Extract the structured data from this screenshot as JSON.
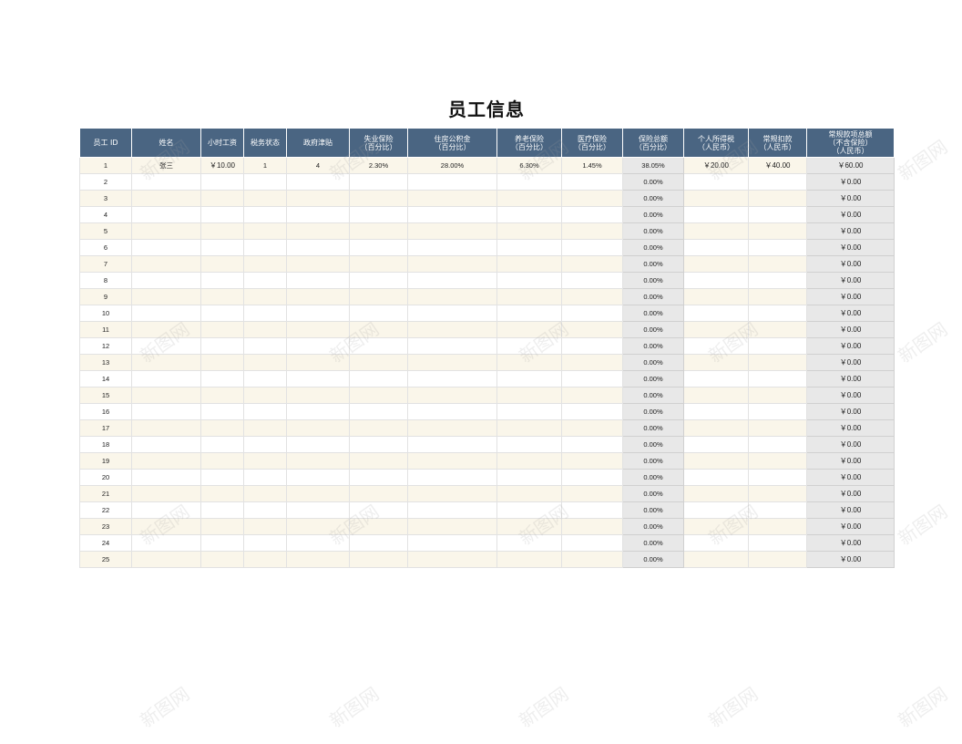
{
  "title": "员工信息",
  "columns": [
    "员工 ID",
    "姓名",
    "小时工资",
    "税务状态",
    "政府津贴",
    "失业保险\n（百分比）",
    "住房公积金\n（百分比）",
    "养老保险\n（百分比）",
    "医疗保险\n（百分比）",
    "保险总额\n（百分比）",
    "个人所得税\n（人民币）",
    "常规扣款\n（人民币）",
    "常规款项总额\n（不含保险）\n（人民币）"
  ],
  "rows": [
    [
      "1",
      "张三",
      "￥10.00",
      "1",
      "4",
      "2.30%",
      "28.00%",
      "6.30%",
      "1.45%",
      "38.05%",
      "￥20.00",
      "￥40.00",
      "￥60.00"
    ],
    [
      "2",
      "",
      "",
      "",
      "",
      "",
      "",
      "",
      "",
      "0.00%",
      "",
      "",
      "￥0.00"
    ],
    [
      "3",
      "",
      "",
      "",
      "",
      "",
      "",
      "",
      "",
      "0.00%",
      "",
      "",
      "￥0.00"
    ],
    [
      "4",
      "",
      "",
      "",
      "",
      "",
      "",
      "",
      "",
      "0.00%",
      "",
      "",
      "￥0.00"
    ],
    [
      "5",
      "",
      "",
      "",
      "",
      "",
      "",
      "",
      "",
      "0.00%",
      "",
      "",
      "￥0.00"
    ],
    [
      "6",
      "",
      "",
      "",
      "",
      "",
      "",
      "",
      "",
      "0.00%",
      "",
      "",
      "￥0.00"
    ],
    [
      "7",
      "",
      "",
      "",
      "",
      "",
      "",
      "",
      "",
      "0.00%",
      "",
      "",
      "￥0.00"
    ],
    [
      "8",
      "",
      "",
      "",
      "",
      "",
      "",
      "",
      "",
      "0.00%",
      "",
      "",
      "￥0.00"
    ],
    [
      "9",
      "",
      "",
      "",
      "",
      "",
      "",
      "",
      "",
      "0.00%",
      "",
      "",
      "￥0.00"
    ],
    [
      "10",
      "",
      "",
      "",
      "",
      "",
      "",
      "",
      "",
      "0.00%",
      "",
      "",
      "￥0.00"
    ],
    [
      "11",
      "",
      "",
      "",
      "",
      "",
      "",
      "",
      "",
      "0.00%",
      "",
      "",
      "￥0.00"
    ],
    [
      "12",
      "",
      "",
      "",
      "",
      "",
      "",
      "",
      "",
      "0.00%",
      "",
      "",
      "￥0.00"
    ],
    [
      "13",
      "",
      "",
      "",
      "",
      "",
      "",
      "",
      "",
      "0.00%",
      "",
      "",
      "￥0.00"
    ],
    [
      "14",
      "",
      "",
      "",
      "",
      "",
      "",
      "",
      "",
      "0.00%",
      "",
      "",
      "￥0.00"
    ],
    [
      "15",
      "",
      "",
      "",
      "",
      "",
      "",
      "",
      "",
      "0.00%",
      "",
      "",
      "￥0.00"
    ],
    [
      "16",
      "",
      "",
      "",
      "",
      "",
      "",
      "",
      "",
      "0.00%",
      "",
      "",
      "￥0.00"
    ],
    [
      "17",
      "",
      "",
      "",
      "",
      "",
      "",
      "",
      "",
      "0.00%",
      "",
      "",
      "￥0.00"
    ],
    [
      "18",
      "",
      "",
      "",
      "",
      "",
      "",
      "",
      "",
      "0.00%",
      "",
      "",
      "￥0.00"
    ],
    [
      "19",
      "",
      "",
      "",
      "",
      "",
      "",
      "",
      "",
      "0.00%",
      "",
      "",
      "￥0.00"
    ],
    [
      "20",
      "",
      "",
      "",
      "",
      "",
      "",
      "",
      "",
      "0.00%",
      "",
      "",
      "￥0.00"
    ],
    [
      "21",
      "",
      "",
      "",
      "",
      "",
      "",
      "",
      "",
      "0.00%",
      "",
      "",
      "￥0.00"
    ],
    [
      "22",
      "",
      "",
      "",
      "",
      "",
      "",
      "",
      "",
      "0.00%",
      "",
      "",
      "￥0.00"
    ],
    [
      "23",
      "",
      "",
      "",
      "",
      "",
      "",
      "",
      "",
      "0.00%",
      "",
      "",
      "￥0.00"
    ],
    [
      "24",
      "",
      "",
      "",
      "",
      "",
      "",
      "",
      "",
      "0.00%",
      "",
      "",
      "￥0.00"
    ],
    [
      "25",
      "",
      "",
      "",
      "",
      "",
      "",
      "",
      "",
      "0.00%",
      "",
      "",
      "￥0.00"
    ]
  ],
  "watermark": "新图网",
  "colors": {
    "header_bg": "#4a6582",
    "band": "#faf6ea",
    "calc_bg": "#e8e8e8"
  }
}
